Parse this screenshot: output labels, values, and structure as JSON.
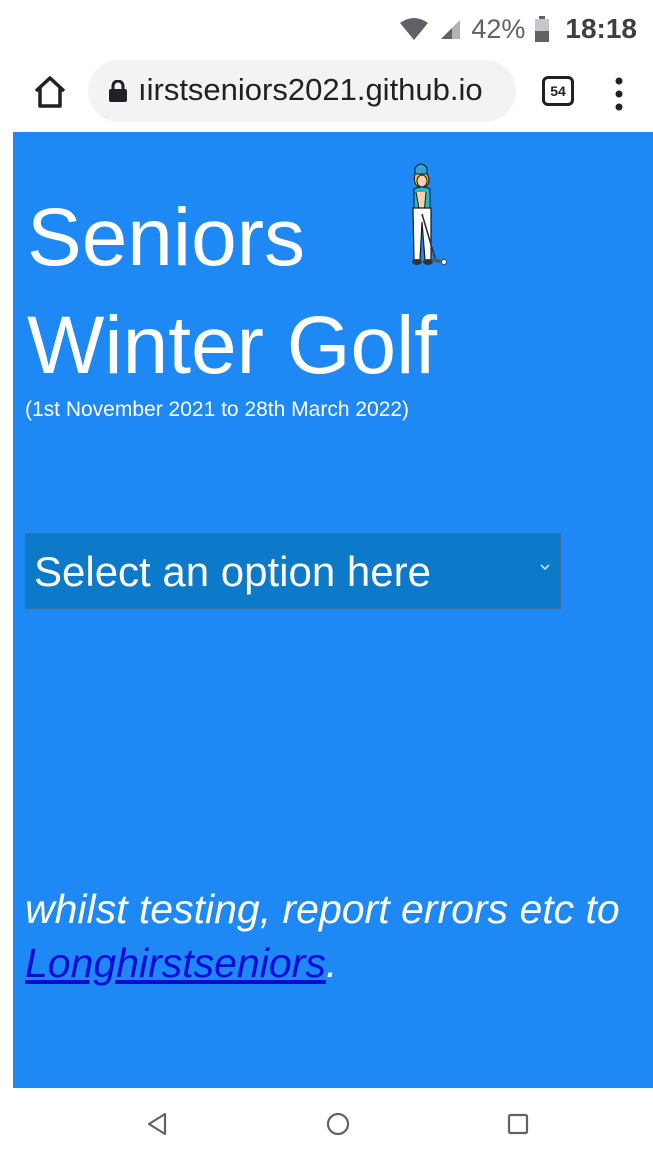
{
  "status_bar": {
    "battery": "42%",
    "time": "18:18"
  },
  "browser": {
    "url": "ıirstseniors2021.github.io",
    "tab_count": "54"
  },
  "page": {
    "title_line1": "Seniors",
    "title_line2": "Winter Golf",
    "subtitle": "(1st November 2021 to 28th March 2022)",
    "select": {
      "selected": "Select an option here"
    },
    "note_text": "whilst testing, report errors etc to ",
    "note_link": "Longhirstseniors",
    "note_end": "."
  },
  "colors": {
    "page_background": "#1e88f5",
    "select_background": "#0c7ac9",
    "link": "#0b0bd8"
  }
}
